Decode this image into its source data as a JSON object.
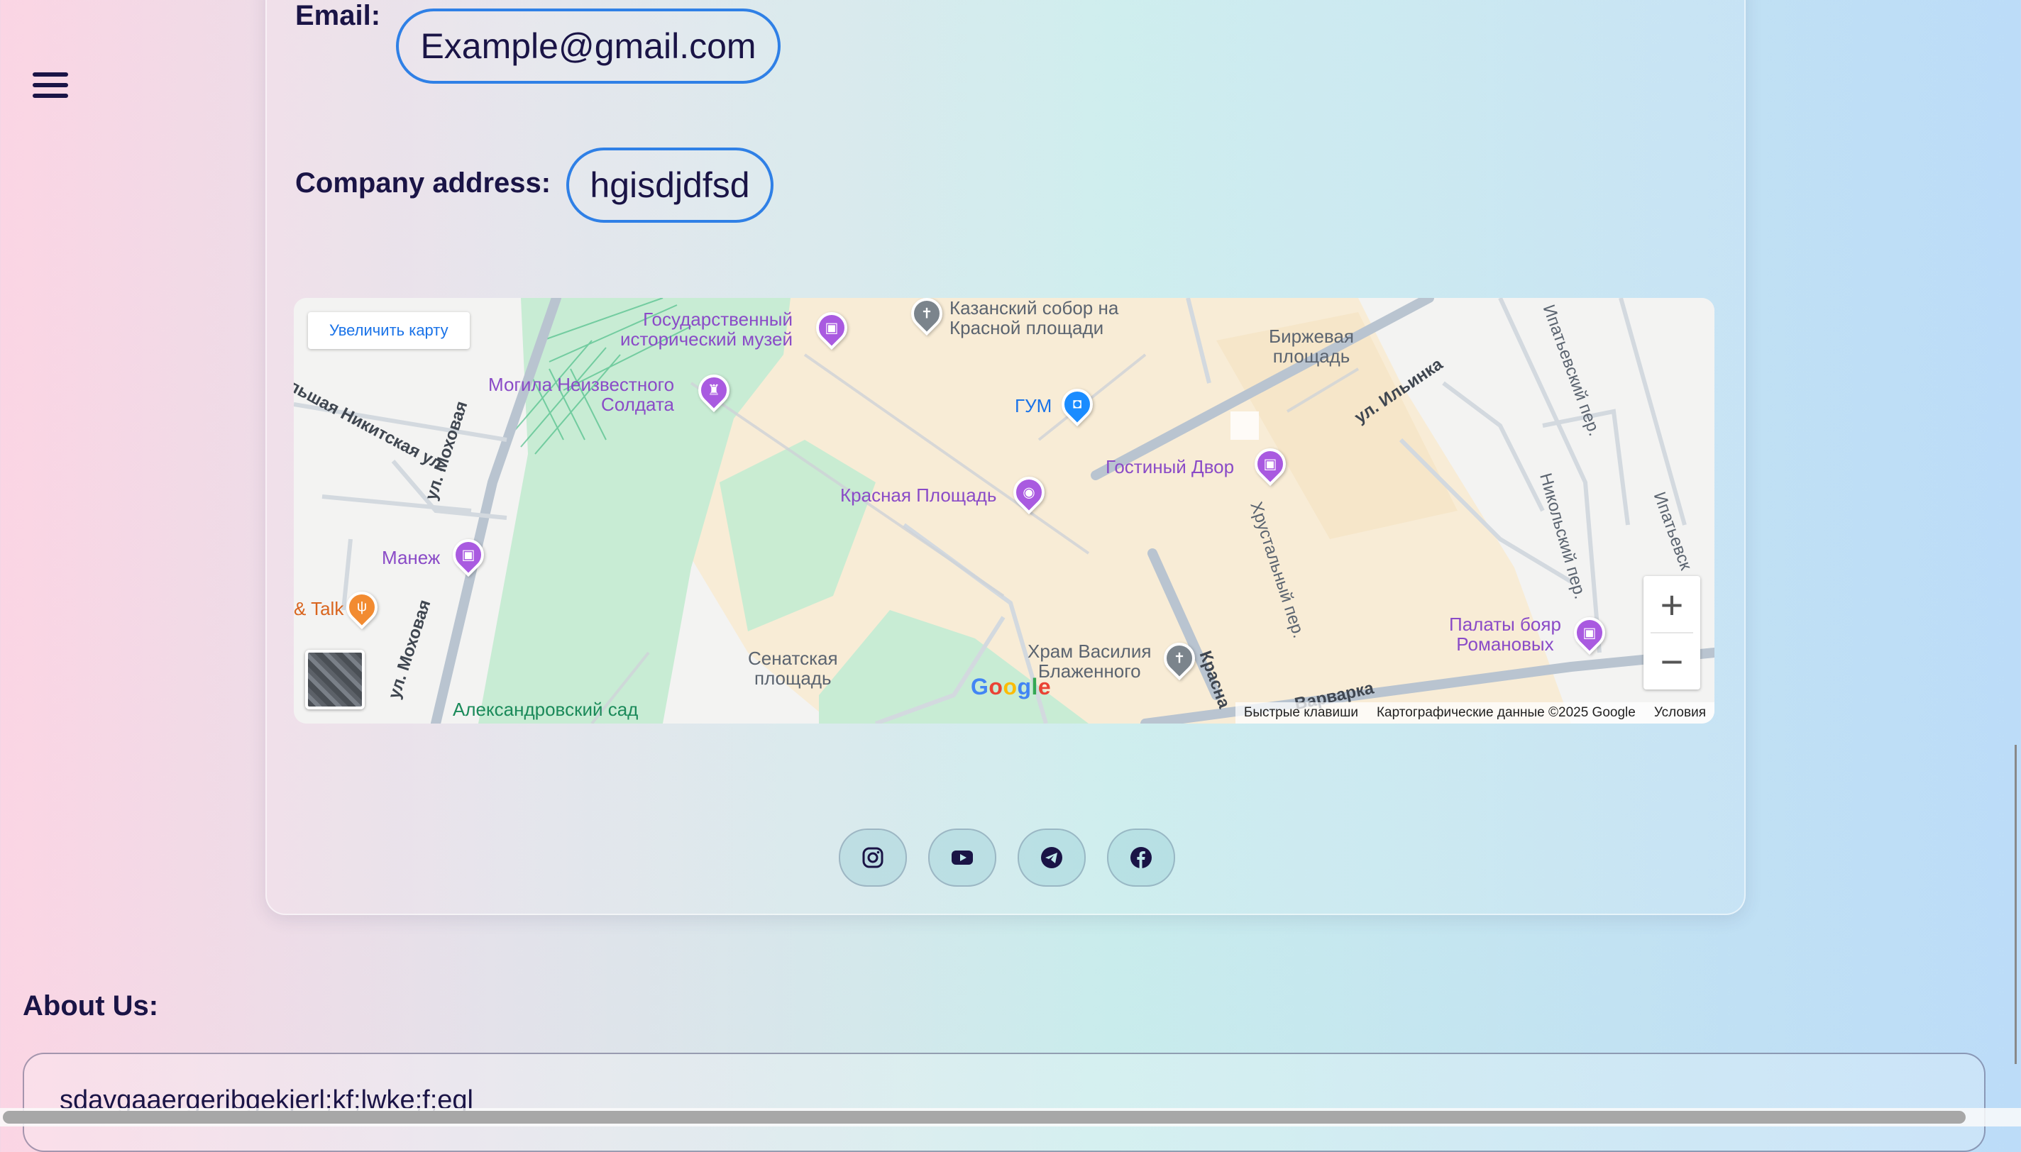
{
  "nav": {
    "menu_icon": "hamburger-icon"
  },
  "contact": {
    "email_label": "Email:",
    "email_value": "Example@gmail.com",
    "address_label": "Company address:",
    "address_value": "hgisdjdfsd"
  },
  "map": {
    "enlarge_label": "Увеличить карту",
    "zoom_in": "+",
    "zoom_out": "−",
    "google_logo": "Google",
    "attribution": {
      "shortcuts": "Быстрые клавиши",
      "data": "Картографические данные ©2025 Google",
      "terms": "Условия"
    },
    "places": {
      "history_museum": "Государственный\nисторический музей",
      "kazan_cathedral": "Казанский собор на\nКрасной площади",
      "exchange_square": "Биржевая\nплощадь",
      "unknown_soldier": "Могила Неизвестного\nСолдата",
      "gum": "ГУМ",
      "gostiny_dvor": "Гостиный Двор",
      "red_square": "Красная Площадь",
      "manezh": "Манеж",
      "talk": "& Talk",
      "senate_square": "Сенатская\nплощадь",
      "st_basil": "Храм Василия\nБлаженного",
      "romanov_chambers": "Палаты бояр\nРомановых",
      "alexander_garden": "Александровский сад"
    },
    "streets": {
      "nikitskaya": "льшая Никитская ул.",
      "mokhovaya_top": "ул. Моховая",
      "mokhovaya_bottom": "ул. Моховая",
      "ilyinka": "ул. Ильинка",
      "ipatievsky_top": "Ипатьевский пер.",
      "ipatievsky_right": "Ипатьевск",
      "nikolsky": "Никольский пер.",
      "khrustalny": "Хрустальный пер.",
      "varvarka": "Варварка",
      "krasnaya": "Красна"
    }
  },
  "socials": [
    {
      "name": "instagram-icon"
    },
    {
      "name": "youtube-icon"
    },
    {
      "name": "telegram-icon"
    },
    {
      "name": "facebook-icon"
    }
  ],
  "about": {
    "heading": "About Us:",
    "text": "sdavgaaergeribgekjerl;kf;lwke;f;eql"
  },
  "colors": {
    "accent_border": "#2f80e6",
    "text": "#1a1446",
    "map_link": "#1a73e8"
  }
}
